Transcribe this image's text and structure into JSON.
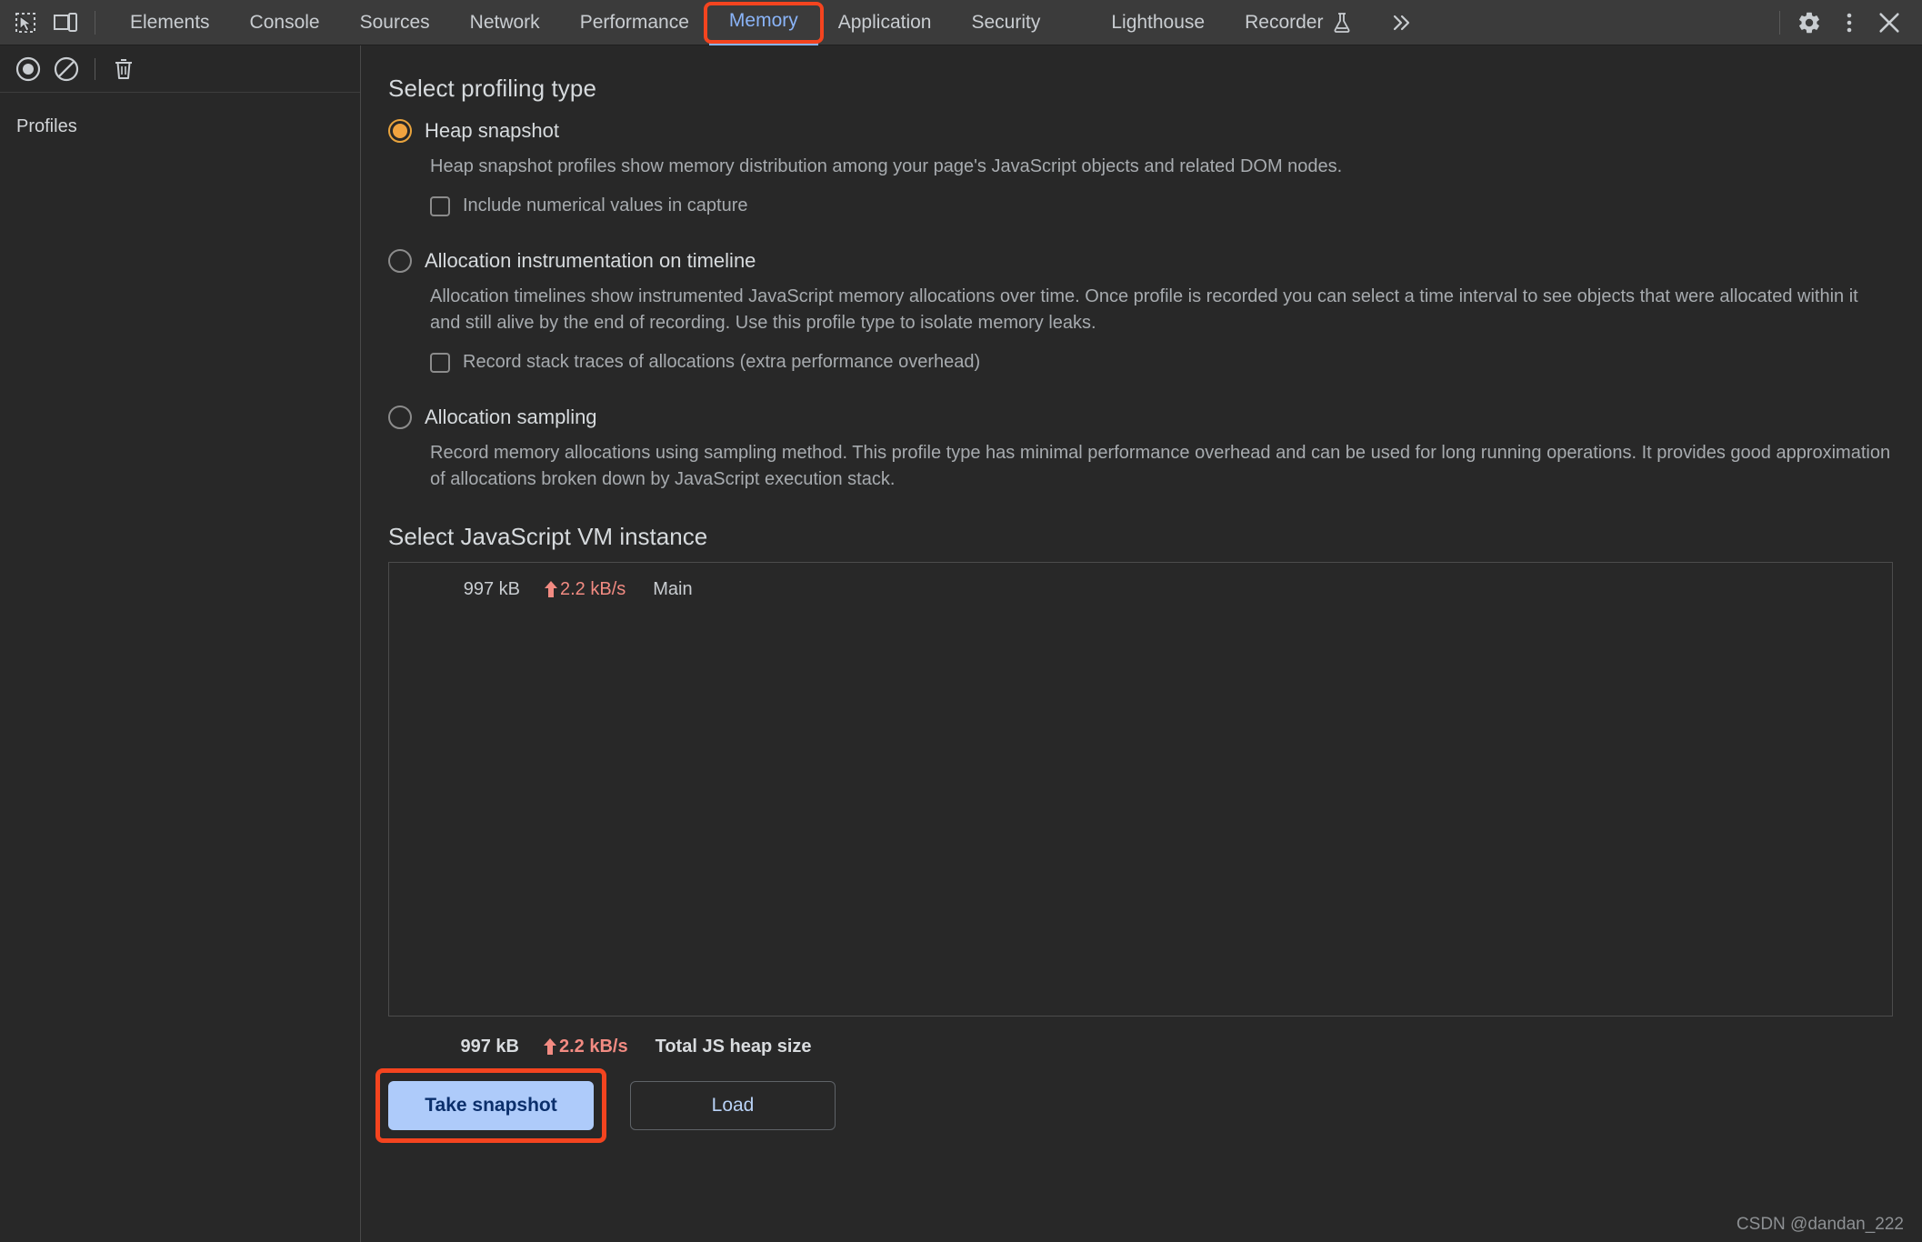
{
  "window": {
    "watermark": "CSDN @dandan_222"
  },
  "toolbar": {
    "inspect_icon": "inspect-element-icon",
    "device_icon": "device-toolbar-icon",
    "settings_icon": "gear-icon",
    "more_icon": "three-dots-vertical-icon",
    "close_icon": "close-icon",
    "more_tabs_icon": "double-chevron-right-icon",
    "tabs": [
      {
        "label": "Elements",
        "active": false
      },
      {
        "label": "Console",
        "active": false
      },
      {
        "label": "Sources",
        "active": false
      },
      {
        "label": "Network",
        "active": false
      },
      {
        "label": "Performance",
        "active": false
      },
      {
        "label": "Memory",
        "active": true,
        "highlighted": true
      },
      {
        "label": "Application",
        "active": false
      },
      {
        "label": "Security",
        "active": false
      },
      {
        "label": "Lighthouse",
        "active": false
      },
      {
        "label": "Recorder",
        "active": false,
        "experimental_icon": "flask-icon"
      }
    ]
  },
  "sidebar": {
    "record_icon": "record-circle-icon",
    "clear_icon": "no-entry-clear-icon",
    "delete_icon": "trash-can-icon",
    "tree_root": "Profiles"
  },
  "main": {
    "profiling_title": "Select profiling type",
    "options": [
      {
        "id": "heap-snapshot",
        "label": "Heap snapshot",
        "selected": true,
        "description": "Heap snapshot profiles show memory distribution among your page's JavaScript objects and related DOM nodes.",
        "sub_checkbox": {
          "label": "Include numerical values in capture",
          "checked": false
        }
      },
      {
        "id": "allocation-instrumentation-on-timeline",
        "label": "Allocation instrumentation on timeline",
        "selected": false,
        "description": "Allocation timelines show instrumented JavaScript memory allocations over time. Once profile is recorded you can select a time interval to see objects that were allocated within it and still alive by the end of recording. Use this profile type to isolate memory leaks.",
        "sub_checkbox": {
          "label": "Record stack traces of allocations (extra performance overhead)",
          "checked": false
        }
      },
      {
        "id": "allocation-sampling",
        "label": "Allocation sampling",
        "selected": false,
        "description": "Record memory allocations using sampling method. This profile type has minimal performance overhead and can be used for long running operations. It provides good approximation of allocations broken down by JavaScript execution stack.",
        "sub_checkbox": null
      }
    ],
    "vm_title": "Select JavaScript VM instance",
    "vm_rows": [
      {
        "size": "997 kB",
        "rate": "2.2 kB/s",
        "name": "Main",
        "trend_icon": "arrow-up-icon"
      }
    ],
    "vm_total": {
      "size": "997 kB",
      "rate": "2.2 kB/s",
      "name": "Total JS heap size",
      "trend_icon": "arrow-up-icon"
    },
    "buttons": {
      "take_snapshot": "Take snapshot",
      "load": "Load"
    }
  },
  "colors": {
    "accent_blue": "#8ab4f8",
    "highlight_red": "#f4441f",
    "radio_orange": "#f0a33f",
    "rate_red": "#f28b82",
    "primary_button_bg": "#aecbfa",
    "primary_button_text": "#0b2f6b",
    "panel_bg": "#282828",
    "tabbar_bg": "#3b3b3b"
  }
}
